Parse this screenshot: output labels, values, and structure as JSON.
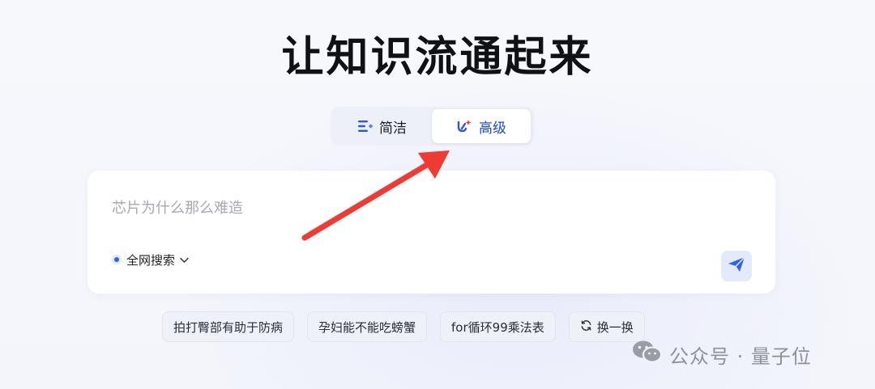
{
  "title": "让知识流通起来",
  "mode_tabs": {
    "simple_label": "简洁",
    "advanced_label": "高级",
    "selected": "高级"
  },
  "search": {
    "placeholder": "芯片为什么那么难造",
    "scope_label": "全网搜索"
  },
  "suggestions": [
    {
      "label": "拍打臀部有助于防病"
    },
    {
      "label": "孕妇能不能吃螃蟹"
    },
    {
      "label": "for循环99乘法表"
    }
  ],
  "refresh_label": "换一换",
  "watermark": "公众号 · 量子位",
  "colors": {
    "accent": "#2f62e8",
    "arrow": "#ee3b33",
    "title": "#0f1115"
  },
  "icons": {
    "simple_tab": "lines-icon",
    "advanced_tab": "sparkle-pen-icon",
    "send": "paper-plane-icon",
    "refresh": "refresh-icon",
    "scope": "dot-icon",
    "dropdown": "chevron-down-icon",
    "watermark": "wechat-icon"
  }
}
